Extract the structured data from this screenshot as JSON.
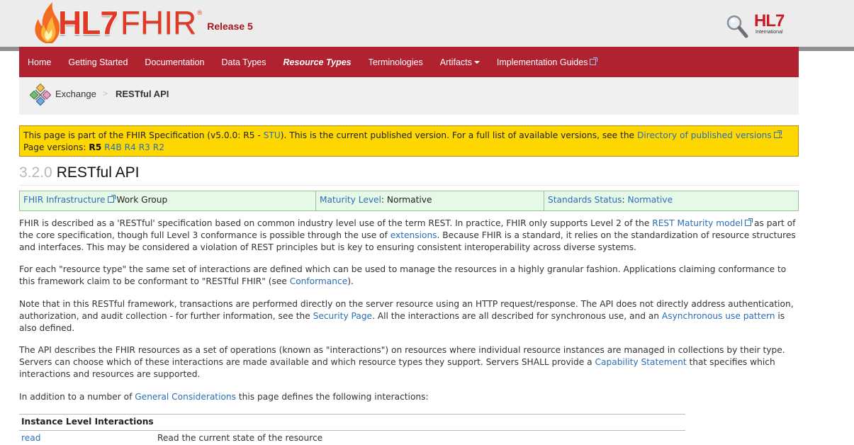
{
  "header": {
    "logo_hl7": "HL7",
    "logo_fhir": "FHIR",
    "logo_reg": "®",
    "release": "Release 5",
    "org_logo_text": "HL7",
    "org_logo_sub": "International"
  },
  "nav": {
    "items": [
      {
        "label": "Home"
      },
      {
        "label": "Getting Started"
      },
      {
        "label": "Documentation"
      },
      {
        "label": "Data Types"
      },
      {
        "label": "Resource Types"
      },
      {
        "label": "Terminologies"
      },
      {
        "label": "Artifacts"
      },
      {
        "label": "Implementation Guides"
      }
    ]
  },
  "breadcrumb": {
    "parent": "Exchange",
    "separator": ">",
    "current": "RESTful API"
  },
  "notice": {
    "t1": "This page is part of the FHIR Specification (v5.0.0: R5 - ",
    "stu_link": "STU",
    "t2": "). This is the current published version. For a full list of available versions, see the ",
    "dir_link": "Directory of published versions",
    "t3": ".",
    "pv_label": "Page versions: ",
    "pv_current": "R5",
    "pv_links": [
      "R4B",
      "R4",
      "R3",
      "R2"
    ]
  },
  "title": {
    "number": "3.2.0",
    "text": "RESTful API"
  },
  "status": {
    "wg_link": "FHIR Infrastructure",
    "wg_suffix": " Work Group",
    "maturity_link": "Maturity Level",
    "maturity_value": ": Normative",
    "standards_link": "Standards Status",
    "standards_sep": ": ",
    "standards_value": "Normative"
  },
  "p1": {
    "a": "FHIR is described as a 'RESTful' specification based on common industry level use of the term REST. In practice, FHIR only supports Level 2 of the ",
    "link1": "REST Maturity model",
    "b": " as part of the core specification, though full Level 3 conformance is possible through the use of ",
    "link2": "extensions",
    "c": ". Because FHIR is a standard, it relies on the standardization of resource structures and interfaces. This may be considered a violation of REST principles but is key to ensuring consistent interoperability across diverse systems."
  },
  "p2": {
    "a": "For each \"resource type\" the same set of interactions are defined which can be used to manage the resources in a highly granular fashion. Applications claiming conformance to this framework claim to be conformant to \"RESTful FHIR\" (see ",
    "link1": "Conformance",
    "b": ")."
  },
  "p3": {
    "a": "Note that in this RESTful framework, transactions are performed directly on the server resource using an HTTP request/response. The API does not directly address authentication, authorization, and audit collection - for further information, see the ",
    "link1": "Security Page",
    "b": ". All the interactions are all described for synchronous use, and an ",
    "link2": "Asynchronous use pattern",
    "c": " is also defined."
  },
  "p4": {
    "a": "The API describes the FHIR resources as a set of operations (known as \"interactions\") on resources where individual resource instances are managed in collections by their type. Servers can choose which of these interactions are made available and which resource types they support. Servers SHALL provide a ",
    "link1": "Capability Statement",
    "b": " that specifies which interactions and resources are supported."
  },
  "p5": {
    "a": "In addition to a number of ",
    "link1": "General Considerations",
    "b": " this page defines the following interactions:"
  },
  "interactions": {
    "header": "Instance Level Interactions",
    "rows": [
      {
        "name": "read",
        "desc": "Read the current state of the resource"
      }
    ]
  },
  "colors": {
    "nav_bg": "#b02230",
    "notice_bg": "#ffd700",
    "status_bg": "#e6f9e6",
    "link": "#2a6eb8"
  }
}
